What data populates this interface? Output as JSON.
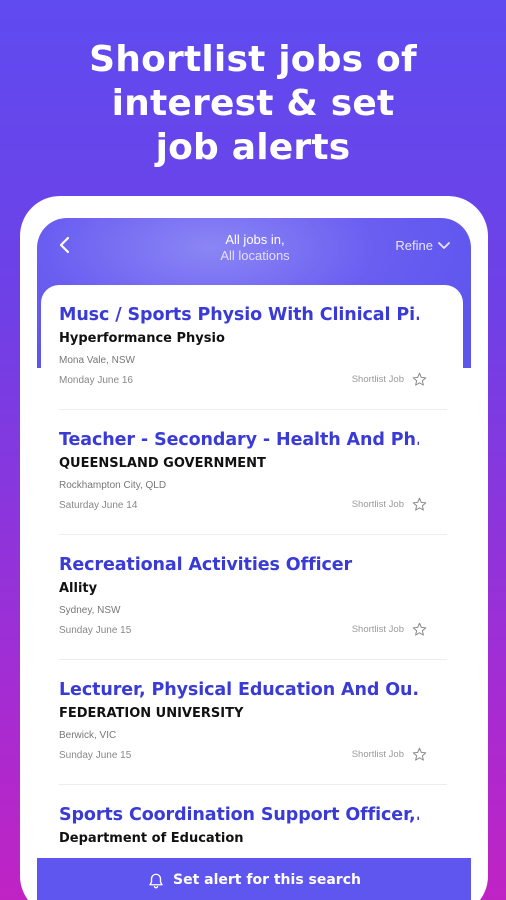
{
  "promo": {
    "line1": "Shortlist jobs of",
    "line2": "interest & set",
    "line3": "job alerts"
  },
  "header": {
    "title": "All jobs in,",
    "location": "All locations",
    "refine_label": "Refine",
    "back_icon": "chevron-left-icon"
  },
  "jobs": [
    {
      "title": "Musc / Sports Physio With Clinical Pi...",
      "company": "Hyperformance Physio",
      "location": "Mona Vale, NSW",
      "date": "Monday June 16",
      "shortlist_label": "Shortlist Job"
    },
    {
      "title": "Teacher - Secondary - Health And Ph...",
      "company": "QUEENSLAND GOVERNMENT",
      "location": "Rockhampton City, QLD",
      "date": "Saturday June 14",
      "shortlist_label": "Shortlist Job"
    },
    {
      "title": "Recreational Activities Officer",
      "company": "Allity",
      "location": "Sydney, NSW",
      "date": "Sunday June 15",
      "shortlist_label": "Shortlist Job"
    },
    {
      "title": "Lecturer, Physical Education And Ou...",
      "company": "FEDERATION UNIVERSITY",
      "location": "Berwick, VIC",
      "date": "Sunday June 15",
      "shortlist_label": "Shortlist Job"
    },
    {
      "title": "Sports Coordination Support Officer,...",
      "company": "Department of Education",
      "location": "",
      "date": "",
      "shortlist_label": ""
    }
  ],
  "alert_bar": {
    "label": "Set alert for this search",
    "icon": "bell-icon"
  },
  "colors": {
    "accent": "#3a3bd6",
    "header": "#5e56ee",
    "background_top": "#5f4bf0",
    "background_bottom": "#c023c4"
  }
}
